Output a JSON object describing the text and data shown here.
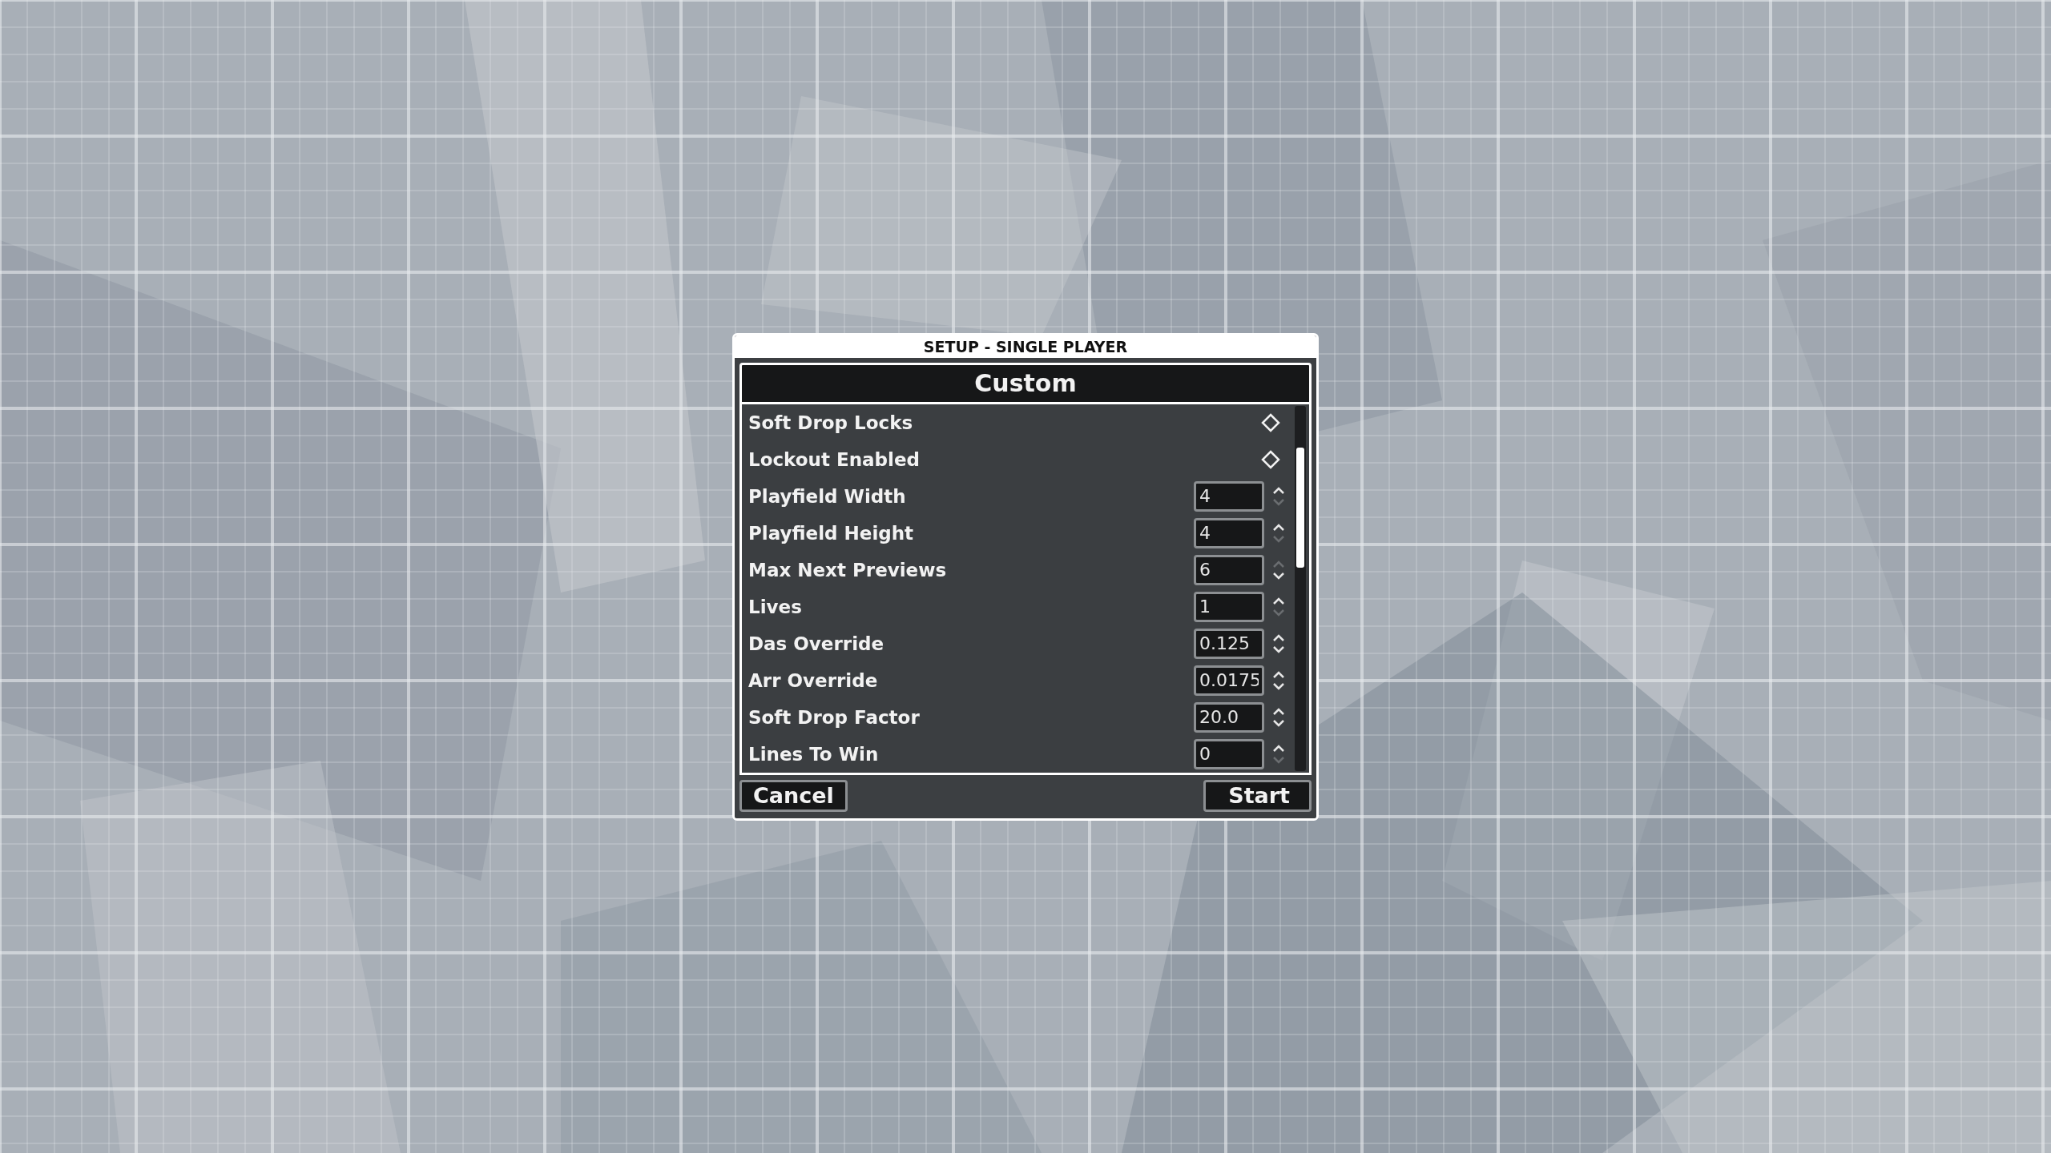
{
  "dialog": {
    "title": "SETUP - SINGLE PLAYER",
    "heading": "Custom",
    "settings": [
      {
        "kind": "toggle",
        "label": "Soft Drop Locks",
        "checked": false
      },
      {
        "kind": "toggle",
        "label": "Lockout Enabled",
        "checked": false
      },
      {
        "kind": "number",
        "label": "Playfield Width",
        "value": "4",
        "up_disabled": false,
        "down_disabled": true
      },
      {
        "kind": "number",
        "label": "Playfield Height",
        "value": "4",
        "up_disabled": false,
        "down_disabled": true
      },
      {
        "kind": "number",
        "label": "Max Next Previews",
        "value": "6",
        "up_disabled": true,
        "down_disabled": false
      },
      {
        "kind": "number",
        "label": "Lives",
        "value": "1",
        "up_disabled": false,
        "down_disabled": true
      },
      {
        "kind": "number",
        "label": "Das Override",
        "value": "0.125",
        "up_disabled": false,
        "down_disabled": false
      },
      {
        "kind": "number",
        "label": "Arr Override",
        "value": "0.0175",
        "up_disabled": false,
        "down_disabled": false
      },
      {
        "kind": "number",
        "label": "Soft Drop Factor",
        "value": "20.0",
        "up_disabled": false,
        "down_disabled": false
      },
      {
        "kind": "number",
        "label": "Lines To Win",
        "value": "0",
        "up_disabled": false,
        "down_disabled": true
      }
    ],
    "buttons": {
      "cancel": "Cancel",
      "start": "Start"
    }
  }
}
